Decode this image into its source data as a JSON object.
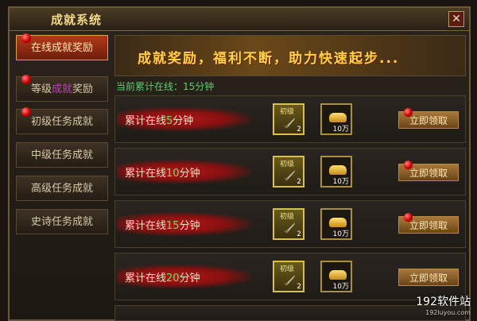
{
  "window": {
    "title": "成就系统",
    "close": "✕"
  },
  "sidebar": {
    "items": [
      {
        "label": "在线成就奖励",
        "active": true
      },
      {
        "label_a": "等级",
        "label_b": "成就",
        "label_c": "奖励",
        "active": false
      },
      {
        "label": "初级任务成就",
        "active": false
      },
      {
        "label": "中级任务成就",
        "active": false
      },
      {
        "label": "高级任务成就",
        "active": false
      },
      {
        "label": "史诗任务成就",
        "active": false
      }
    ]
  },
  "banner": {
    "text": "成就奖励，福利不断，助力快速起步..."
  },
  "online": {
    "text": "当前累计在线：15分钟"
  },
  "rewards": [
    {
      "prefix": "累计在线",
      "minutes": "5",
      "suffix": "分钟",
      "item1_tag": "初级",
      "item1_count": "2",
      "item2_count": "10万",
      "button": "立即领取"
    },
    {
      "prefix": "累计在线",
      "minutes": "10",
      "suffix": "分钟",
      "item1_tag": "初级",
      "item1_count": "2",
      "item2_count": "10万",
      "button": "立即领取"
    },
    {
      "prefix": "累计在线",
      "minutes": "15",
      "suffix": "分钟",
      "item1_tag": "初级",
      "item1_count": "2",
      "item2_count": "10万",
      "button": "立即领取"
    },
    {
      "prefix": "累计在线",
      "minutes": "20",
      "suffix": "分钟",
      "item1_tag": "初级",
      "item1_count": "2",
      "item2_count": "10万",
      "button": "立即领取"
    }
  ],
  "watermark": {
    "main": "192软件站",
    "sub": "192luyou.com"
  },
  "colors": {
    "accent_red": "#b23a1a",
    "online_green": "#58d070",
    "gold": "#ffd24a"
  }
}
